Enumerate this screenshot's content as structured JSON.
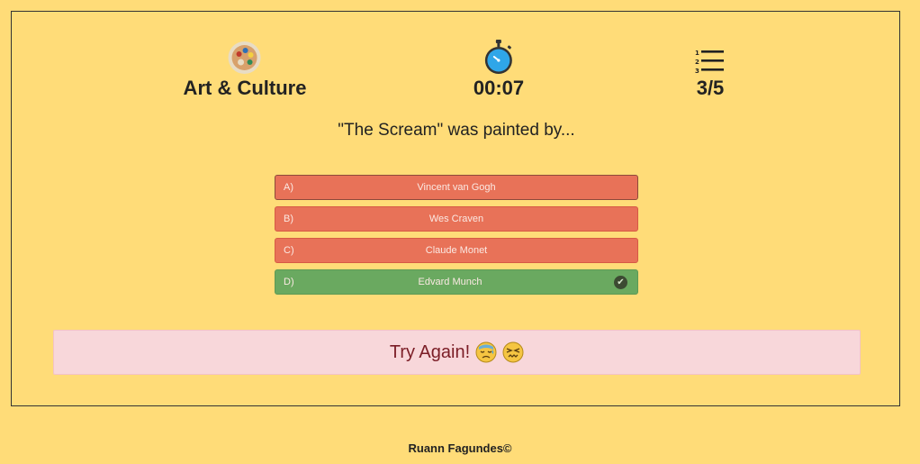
{
  "stats": {
    "category": {
      "label": "Art & Culture",
      "icon": "palette-icon"
    },
    "timer": {
      "label": "00:07",
      "icon": "stopwatch-icon"
    },
    "progress": {
      "label": "3/5",
      "icon": "numbered-list-icon"
    }
  },
  "question": "\"The Scream\" was painted by...",
  "options": [
    {
      "letter": "A)",
      "text": "Vincent van Gogh",
      "state": "wrong"
    },
    {
      "letter": "B)",
      "text": "Wes Craven",
      "state": "wrong"
    },
    {
      "letter": "C)",
      "text": "Claude Monet",
      "state": "wrong"
    },
    {
      "letter": "D)",
      "text": "Edvard Munch",
      "state": "correct",
      "icon": "check-icon"
    }
  ],
  "result": {
    "message": "Try Again!",
    "icons": [
      "sad-sweat-face-icon",
      "confounded-face-icon"
    ]
  },
  "footer": "Ruann Fagundes©",
  "colors": {
    "background": "#ffdc78",
    "wrong": "#e87258",
    "correct": "#6aa960",
    "result_bg": "#f8d7da",
    "result_text": "#7b1d26"
  }
}
